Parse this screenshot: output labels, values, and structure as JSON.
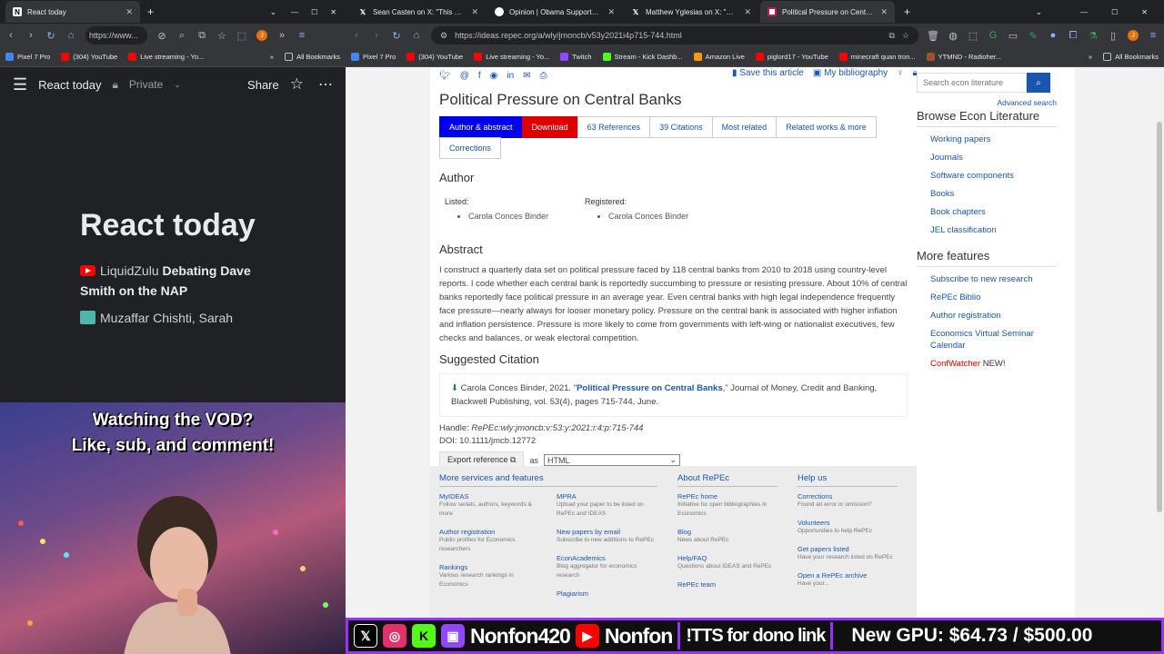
{
  "left_window": {
    "tab_title": "React today",
    "url": "https://www...",
    "bookmarks": [
      "Pixel 7 Pro",
      "(304) YouTube",
      "Live streaming - Yo...",
      "All Bookmarks"
    ],
    "reader": {
      "title": "React today",
      "private_label": "Private",
      "share_label": "Share",
      "hero": "React today",
      "stories": [
        {
          "source": "LiquidZulu",
          "headline": "Debating Dave Smith on the NAP"
        },
        {
          "source": "Muzaffar Chishti, Sarah",
          "headline": ""
        }
      ]
    }
  },
  "right_window": {
    "tabs": [
      {
        "title": "Sean Casten on X: \"This Yglesia...",
        "active": false
      },
      {
        "title": "Opinion | Obama Supported It...",
        "active": false
      },
      {
        "title": "Matthew Yglesias on X: \"Okay...",
        "active": false
      },
      {
        "title": "Political Pressure on Central Ba...",
        "active": true
      }
    ],
    "url": "https://ideas.repec.org/a/wly/jmoncb/v53y2021i4p715-744.html",
    "bookmarks": [
      "Pixel 7 Pro",
      "(304) YouTube",
      "Live streaming - Yo...",
      "Twitch",
      "Stream - Kick Dashb...",
      "Amazon Live",
      "piglord17 - YouTube",
      "minecraft quan tron...",
      "YTMND - Radioher...",
      "All Bookmarks"
    ]
  },
  "article": {
    "save_label": "Save this article",
    "bibliography_label": "My bibliography",
    "title": "Political Pressure on Central Banks",
    "tabs": [
      "Author & abstract",
      "Download",
      "63 References",
      "39 Citations",
      "Most related",
      "Related works & more",
      "Corrections"
    ],
    "author_heading": "Author",
    "listed_label": "Listed:",
    "registered_label": "Registered:",
    "listed_author": "Carola Conces Binder",
    "registered_author": "Carola Conces Binder",
    "abstract_heading": "Abstract",
    "abstract": "I construct a quarterly data set on political pressure faced by 118 central banks from 2010 to 2018 using country-level reports. I code whether each central bank is reportedly succumbing to pressure or resisting pressure. About 10% of central banks reportedly face political pressure in an average year. Even central banks with high legal independence frequently face pressure—nearly always for looser monetary policy. Pressure on the central bank is associated with higher inflation and inflation persistence. Pressure is more likely to come from governments with left-wing or nationalist executives, few checks and balances, or weak electoral competition.",
    "citation_heading": "Suggested Citation",
    "citation_pre": "Carola Conces Binder, 2021. \"",
    "citation_link": "Political Pressure on Central Banks",
    "citation_post": ",\" Journal of Money, Credit and Banking, Blackwell Publishing, vol. 53(4), pages 715-744, June.",
    "handle_label": "Handle:",
    "handle": "RePEc:wly:jmoncb:v:53:y:2021:i:4:p:715-744",
    "doi_label": "DOI:",
    "doi": "10.1111/jmcb.12772",
    "export_label": "Export reference",
    "export_as": "as",
    "export_format": "HTML"
  },
  "sidebar": {
    "search_placeholder": "Search econ literature",
    "advanced": "Advanced search",
    "browse_heading": "Browse Econ Literature",
    "browse_items": [
      "Working papers",
      "Journals",
      "Software components",
      "Books",
      "Book chapters",
      "JEL classification"
    ],
    "features_heading": "More features",
    "features_items": [
      "Subscribe to new research",
      "RePEc Biblio",
      "Author registration",
      "Economics Virtual Seminar Calendar"
    ],
    "confwatcher": "ConfWatcher",
    "confwatcher_new": "NEW!"
  },
  "footer": {
    "col1_heading": "More services and features",
    "col1a": [
      {
        "t": "MyIDEAS",
        "d": "Follow serials, authors, keywords & more"
      },
      {
        "t": "Author registration",
        "d": "Public profiles for Economics researchers"
      },
      {
        "t": "Rankings",
        "d": "Various research rankings in Economics"
      }
    ],
    "col1b": [
      {
        "t": "MPRA",
        "d": "Upload your paper to be listed on RePEc and IDEAS"
      },
      {
        "t": "New papers by email",
        "d": "Subscribe to new additions to RePEc"
      },
      {
        "t": "EconAcademics",
        "d": "Blog aggregator for economics research"
      },
      {
        "t": "Plagiarism",
        "d": ""
      }
    ],
    "col2_heading": "About RePEc",
    "col2": [
      {
        "t": "RePEc home",
        "d": "Initiative for open bibliographies in Economics"
      },
      {
        "t": "Blog",
        "d": "News about RePEc"
      },
      {
        "t": "Help/FAQ",
        "d": "Questions about IDEAS and RePEc"
      },
      {
        "t": "RePEc team",
        "d": ""
      }
    ],
    "col3_heading": "Help us",
    "col3": [
      {
        "t": "Corrections",
        "d": "Found an error or omission?"
      },
      {
        "t": "Volunteers",
        "d": "Opportunities to help RePEc"
      },
      {
        "t": "Get papers listed",
        "d": "Have your research listed on RePEc"
      },
      {
        "t": "Open a RePEc archive",
        "d": "Have your..."
      }
    ]
  },
  "stream": {
    "overlay_line1": "Watching the VOD?",
    "overlay_line2": "Like, sub, and comment!",
    "ticker_name1": "Nonfon420",
    "ticker_name2": "Nonfon",
    "ticker_tts": "!TTS for dono link",
    "gpu_goal": "New GPU: $64.73 / $500.00"
  },
  "colors": {
    "accent_blue": "#1a55b0",
    "download_red": "#e00000",
    "active_tab_blue": "#0000ee",
    "ticker_border": "#9b30ff"
  }
}
